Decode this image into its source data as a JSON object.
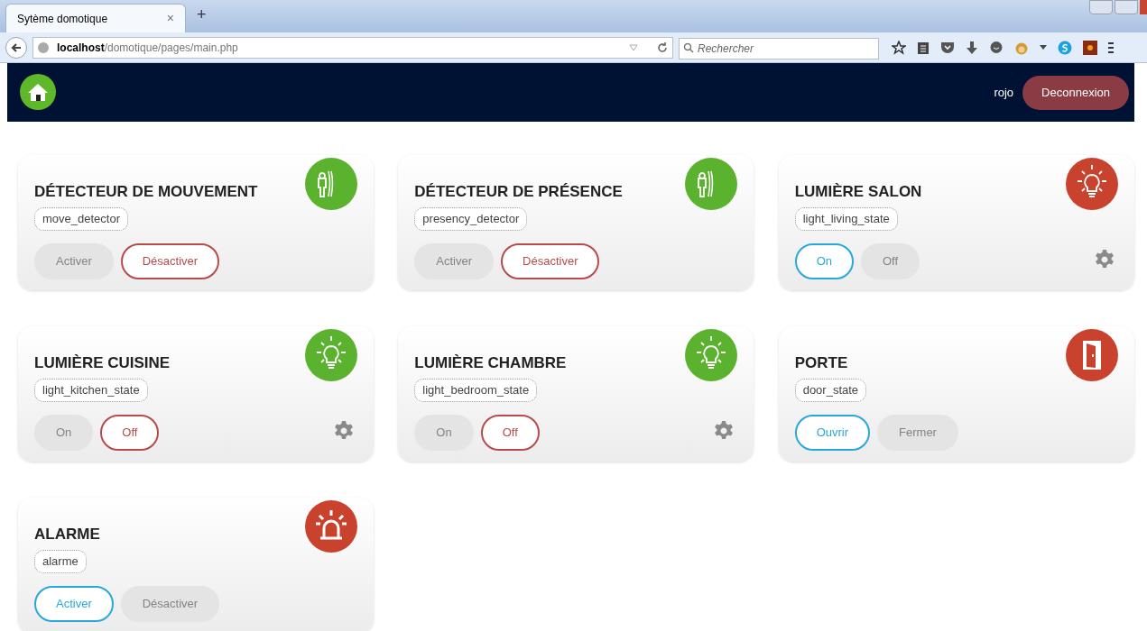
{
  "browser": {
    "tab_title": "Sytème domotique",
    "tab_close": "×",
    "new_tab": "+",
    "url": "**localhost**/domotique/pages/main.php",
    "search": {
      "placeholder": "Rechercher"
    }
  },
  "header": {
    "user": "rojo",
    "logout_button": "Deconnexion"
  },
  "devices": [
    {
      "title": "DÉTECTEUR DE MOUVEMENT",
      "tag": "move_detector",
      "kind": "person",
      "color": "#5bb22e",
      "settings": false,
      "buttons": [
        {
          "label": "Activer",
          "disabled": true
        },
        {
          "label": "Désactiver",
          "disabled": false
        }
      ]
    },
    {
      "title": "DÉTECTEUR DE PRÉSENCE",
      "tag": "presency_detector",
      "kind": "person",
      "color": "#5bb22e",
      "settings": false,
      "buttons": [
        {
          "label": "Activer",
          "disabled": true
        },
        {
          "label": "Désactiver",
          "disabled": false
        }
      ]
    },
    {
      "title": "LUMIÈRE SALON",
      "tag": "light_living_state",
      "kind": "bulb",
      "color": "#c9422e",
      "settings": true,
      "buttons": [
        {
          "label": "On",
          "disabled": false
        },
        {
          "label": "Off",
          "disabled": true
        }
      ]
    },
    {
      "title": "LUMIÈRE CUISINE",
      "tag": "light_kitchen_state",
      "kind": "bulb",
      "color": "#5bb22e",
      "settings": true,
      "buttons": [
        {
          "label": "On",
          "disabled": true
        },
        {
          "label": "Off",
          "disabled": false
        }
      ]
    },
    {
      "title": "LUMIÈRE CHAMBRE",
      "tag": "light_bedroom_state",
      "kind": "bulb",
      "color": "#5bb22e",
      "settings": true,
      "buttons": [
        {
          "label": "On",
          "disabled": true
        },
        {
          "label": "Off",
          "disabled": false
        }
      ]
    },
    {
      "title": "PORTE",
      "tag": "door_state",
      "kind": "door",
      "color": "#c9422e",
      "settings": false,
      "buttons": [
        {
          "label": "Ouvrir",
          "disabled": false
        },
        {
          "label": "Fermer",
          "disabled": true
        }
      ]
    },
    {
      "title": "ALARME",
      "tag": "alarme",
      "kind": "alarm",
      "color": "#c9422e",
      "settings": false,
      "buttons": [
        {
          "label": "Activer",
          "disabled": false
        },
        {
          "label": "Désactiver",
          "disabled": true
        }
      ]
    }
  ]
}
